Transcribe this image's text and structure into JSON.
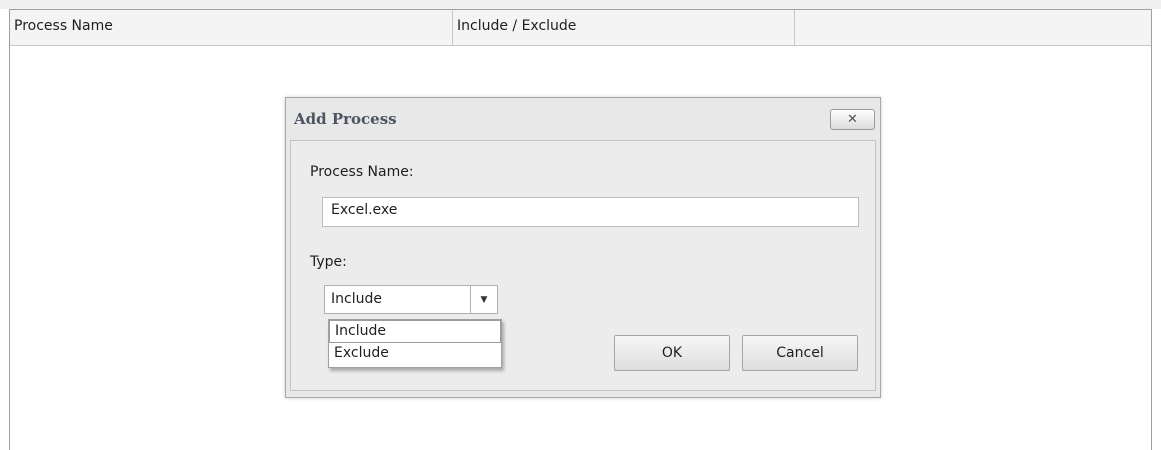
{
  "grid": {
    "columns": [
      "Process Name",
      "Include / Exclude",
      ""
    ]
  },
  "dialog": {
    "title": "Add Process",
    "close_icon": "close-icon",
    "close_glyph": "✕",
    "process_name_label": "Process Name:",
    "process_name_value": "Excel.exe",
    "type_label": "Type:",
    "type_selected": "Include",
    "type_options": [
      "Include",
      "Exclude"
    ],
    "dropdown_arrow_glyph": "▼",
    "ok_label": "OK",
    "cancel_label": "Cancel"
  }
}
